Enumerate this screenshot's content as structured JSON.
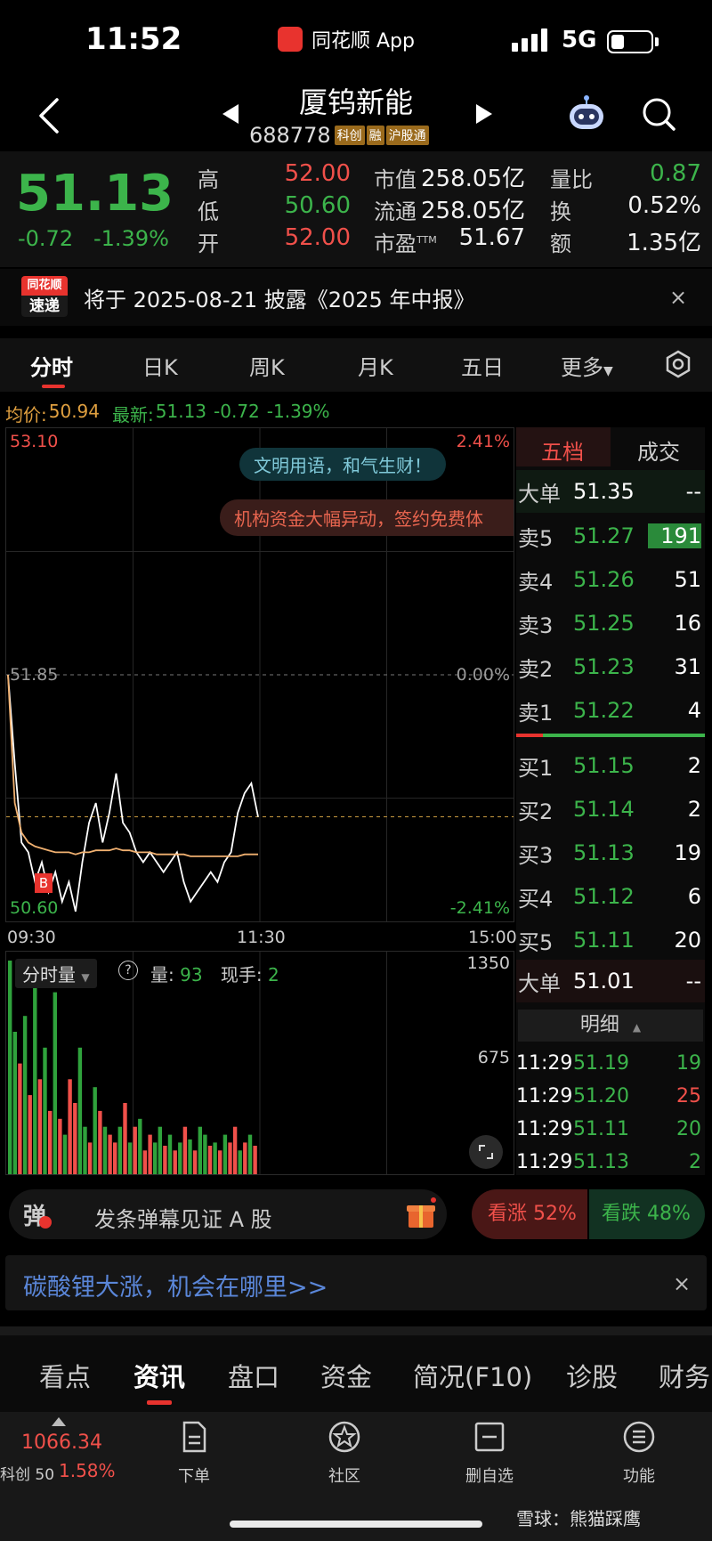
{
  "status_bar": {
    "time": "11:52",
    "app": "同花顺 App",
    "network": "5G"
  },
  "header": {
    "stock_name": "厦钨新能",
    "stock_code": "688778",
    "tags": [
      "科创",
      "融",
      "沪股通"
    ]
  },
  "quote": {
    "price": "51.13",
    "change": "-0.72",
    "change_pct": "-1.39%",
    "high_label": "高",
    "high": "52.00",
    "low_label": "低",
    "low": "50.60",
    "open_label": "开",
    "open": "52.00",
    "mktcap_label": "市值",
    "mktcap": "258.05亿",
    "float_label": "流通",
    "float": "258.05亿",
    "pe_label": "市盈",
    "pe_sup": "TTM",
    "pe": "51.67",
    "vol_ratio_label": "量比",
    "vol_ratio": "0.87",
    "turnover_label": "换",
    "turnover": "0.52%",
    "amount_label": "额",
    "amount": "1.35亿"
  },
  "notice": {
    "badge_top": "同花顺",
    "badge_bottom": "速递",
    "text": "将于 2025-08-21 披露《2025 年中报》",
    "close": "×"
  },
  "chart_tabs": [
    "分时",
    "日K",
    "周K",
    "月K",
    "五日",
    "更多"
  ],
  "avg_row": {
    "avg_label": "均价:",
    "avg": "50.94",
    "latest_label": "最新:",
    "latest": "51.13",
    "chg": "-0.72",
    "pct": "-1.39%"
  },
  "chart": {
    "top_price": "53.10",
    "top_pct": "2.41%",
    "mid_price": "51.85",
    "mid_pct": "0.00%",
    "bottom_price": "50.60",
    "bottom_pct": "-2.41%",
    "x_labels": [
      "09:30",
      "11:30",
      "15:00"
    ],
    "bubble1": "文明用语，和气生财！",
    "bubble2": "机构资金大幅异动，签约免费体",
    "marker": "B"
  },
  "chart_data": {
    "type": "line",
    "title": "",
    "ylim": [
      50.6,
      53.1
    ],
    "ref": 51.85,
    "series": [
      {
        "values": [
          51.85,
          51.4,
          51.0,
          50.95,
          50.8,
          50.9,
          50.75,
          50.85,
          50.7,
          50.8,
          50.65,
          50.9,
          51.1,
          51.2,
          51.0,
          51.15,
          51.35,
          51.1,
          51.05,
          50.95,
          50.9,
          50.95,
          50.9,
          50.85,
          50.9,
          50.95,
          50.8,
          50.7,
          50.75,
          50.8,
          50.85,
          50.8,
          50.9,
          50.95,
          51.15,
          51.25,
          51.3,
          51.13
        ]
      },
      {
        "values": [
          51.85,
          51.2,
          51.05,
          51.0,
          50.98,
          50.97,
          50.96,
          50.95,
          50.95,
          50.95,
          50.94,
          50.95,
          50.95,
          50.96,
          50.96,
          50.96,
          50.97,
          50.96,
          50.96,
          50.95,
          50.95,
          50.95,
          50.94,
          50.94,
          50.94,
          50.94,
          50.94,
          50.93,
          50.93,
          50.93,
          50.93,
          50.93,
          50.93,
          50.93,
          50.93,
          50.94,
          50.94,
          50.94
        ]
      }
    ],
    "volume": {
      "ymax": 1350,
      "mid": 675,
      "values": [
        1350,
        900,
        700,
        1000,
        500,
        1300,
        600,
        800,
        400,
        1150,
        350,
        250,
        600,
        450,
        800,
        300,
        200,
        550,
        400,
        300,
        250,
        200,
        300,
        450,
        200,
        300,
        350,
        150,
        250,
        200,
        300,
        180,
        250,
        150,
        200,
        300,
        220,
        150,
        300,
        250,
        180,
        200,
        150,
        250,
        200,
        300,
        150,
        200,
        250,
        180
      ],
      "colors": [
        "g",
        "g",
        "r",
        "g",
        "r",
        "g",
        "r",
        "g",
        "r",
        "g",
        "r",
        "g",
        "r",
        "r",
        "g",
        "g",
        "r",
        "g",
        "r",
        "g",
        "r",
        "r",
        "g",
        "r",
        "g",
        "r",
        "g",
        "r",
        "r",
        "g",
        "g",
        "r",
        "g",
        "r",
        "g",
        "r",
        "g",
        "r",
        "g",
        "g",
        "r",
        "g",
        "r",
        "g",
        "r",
        "r",
        "g",
        "r",
        "g",
        "r"
      ]
    }
  },
  "volume_panel": {
    "selector": "分时量",
    "help": "?",
    "vol_label": "量:",
    "vol": "93",
    "cur_label": "现手:",
    "cur": "2",
    "max": "1350",
    "mid": "675"
  },
  "book": {
    "tab_a": "五档",
    "tab_b": "成交",
    "big_sell": {
      "label": "大单",
      "price": "51.35",
      "qty": "--"
    },
    "sells": [
      {
        "label": "卖5",
        "price": "51.27",
        "qty": "191"
      },
      {
        "label": "卖4",
        "price": "51.26",
        "qty": "51"
      },
      {
        "label": "卖3",
        "price": "51.25",
        "qty": "16"
      },
      {
        "label": "卖2",
        "price": "51.23",
        "qty": "31"
      },
      {
        "label": "卖1",
        "price": "51.22",
        "qty": "4"
      }
    ],
    "buys": [
      {
        "label": "买1",
        "price": "51.15",
        "qty": "2"
      },
      {
        "label": "买2",
        "price": "51.14",
        "qty": "2"
      },
      {
        "label": "买3",
        "price": "51.13",
        "qty": "19"
      },
      {
        "label": "买4",
        "price": "51.12",
        "qty": "6"
      },
      {
        "label": "买5",
        "price": "51.11",
        "qty": "20"
      }
    ],
    "big_buy": {
      "label": "大单",
      "price": "51.01",
      "qty": "--"
    },
    "detail_title": "明细",
    "ticks": [
      {
        "time": "11:29",
        "price": "51.19",
        "qty": "19",
        "dir": "green"
      },
      {
        "time": "11:29",
        "price": "51.20",
        "qty": "25",
        "dir": "red"
      },
      {
        "time": "11:29",
        "price": "51.11",
        "qty": "20",
        "dir": "green"
      },
      {
        "time": "11:29",
        "price": "51.13",
        "qty": "2",
        "dir": "green"
      }
    ]
  },
  "danmu": {
    "icon": "弹",
    "text": "发条弹幕见证 A 股"
  },
  "vote": {
    "up": "看涨 52%",
    "down": "看跌 48%"
  },
  "promo": {
    "text": "碳酸锂大涨，机会在哪里>>",
    "close": "×"
  },
  "info_tabs": [
    "看点",
    "资讯",
    "盘口",
    "资金",
    "简况(F10)",
    "诊股",
    "财务"
  ],
  "bottom": {
    "index_value": "1066.34",
    "index_name": "科创 50",
    "index_pct": "1.58%",
    "nav": [
      "下单",
      "社区",
      "删自选",
      "功能"
    ],
    "watermark": "雪球：熊猫踩鹰"
  }
}
